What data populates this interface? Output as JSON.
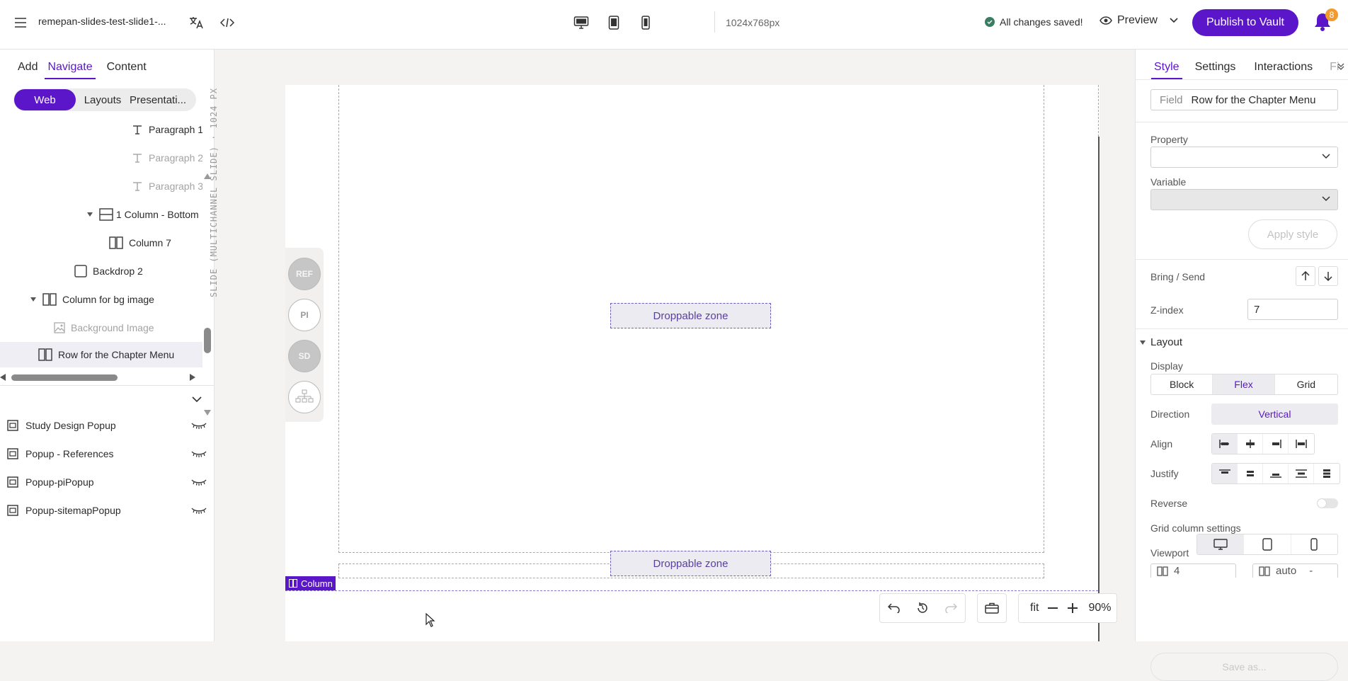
{
  "header": {
    "doc_title": "remepan-slides-test-slide1-...",
    "resolution": "1024x768px",
    "save_status": "All changes saved!",
    "preview_label": "Preview",
    "publish_label": "Publish to Vault",
    "notification_count": "8",
    "accent_color": "#5b16c9"
  },
  "left": {
    "tabs": [
      "Add",
      "Navigate",
      "Content"
    ],
    "segment": [
      "Web",
      "Layouts",
      "Presentati..."
    ],
    "tree": [
      {
        "label": "Paragraph 1",
        "icon": "text-icon"
      },
      {
        "label": "Paragraph 2",
        "icon": "text-icon"
      },
      {
        "label": "Paragraph 3",
        "icon": "text-icon"
      },
      {
        "label": "1 Column - Bottom",
        "icon": "row-icon"
      },
      {
        "label": "Column 7",
        "icon": "column-icon"
      },
      {
        "label": "Backdrop 2",
        "icon": "backdrop-icon"
      },
      {
        "label": "Column for bg image",
        "icon": "column-icon"
      },
      {
        "label": "Background Image",
        "icon": "image-icon"
      },
      {
        "label": "Row for the Chapter Menu",
        "icon": "column-icon"
      }
    ],
    "popups": [
      "Study Design Popup",
      "Popup - References",
      "Popup-piPopup",
      "Popup-sitemapPopup"
    ]
  },
  "canvas": {
    "rotated_label": "SLIDE (MULTICHANNEL SLIDE) · 1024 PX",
    "dropzone_label": "Droppable zone",
    "side_buttons": [
      "REF",
      "PI",
      "SD",
      "sitemap-icon"
    ],
    "column_tag": "Column",
    "zoom_fit": "fit",
    "zoom_value": "90%"
  },
  "right": {
    "tabs": [
      "Style",
      "Settings",
      "Interactions",
      "Fi"
    ],
    "field_key": "Field",
    "field_value": "Row for the Chapter Menu",
    "property_label": "Property",
    "variable_label": "Variable",
    "apply_label": "Apply style",
    "bring_send_label": "Bring / Send",
    "zindex_label": "Z-index",
    "zindex_value": "7",
    "layout_label": "Layout",
    "display_label": "Display",
    "display_options": [
      "Block",
      "Flex",
      "Grid"
    ],
    "direction_label": "Direction",
    "direction_value": "Vertical",
    "align_label": "Align",
    "justify_label": "Justify",
    "reverse_label": "Reverse",
    "grid_label": "Grid column settings",
    "viewport_label": "Viewport",
    "grid_columns": "4",
    "grid_auto": "auto",
    "save_as_label": "Save as..."
  }
}
